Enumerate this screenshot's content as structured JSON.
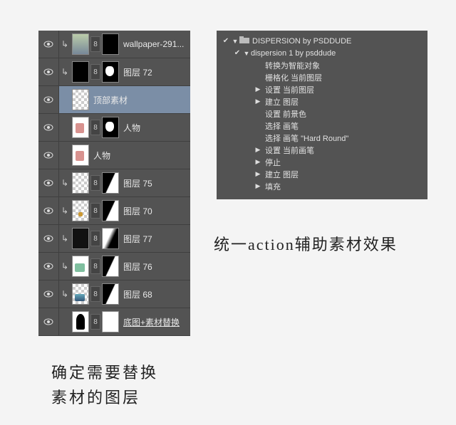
{
  "layers": {
    "items": [
      {
        "name": "wallpaper-291...",
        "clip": true,
        "mask": "black",
        "thumb": "photo"
      },
      {
        "name": "图层 72",
        "clip": true,
        "mask": "shape",
        "thumb": "black"
      },
      {
        "name": "顶部素材",
        "selected": true,
        "mask": null,
        "thumb": "checker"
      },
      {
        "name": "人物",
        "clip": false,
        "mask": "shape",
        "thumb": "person",
        "link": true
      },
      {
        "name": "人物",
        "clip": false,
        "mask": null,
        "thumb": "person"
      },
      {
        "name": "图层 75",
        "clip": true,
        "mask": "diag",
        "thumb": "checker",
        "link": true
      },
      {
        "name": "图层 70",
        "clip": true,
        "mask": "diag",
        "thumb": "checker-dot",
        "link": true
      },
      {
        "name": "图层 77",
        "clip": true,
        "mask": "diag2",
        "thumb": "dark",
        "link": true
      },
      {
        "name": "图层 76",
        "clip": true,
        "mask": "diag",
        "thumb": "photo2",
        "link": true
      },
      {
        "name": "图层 68",
        "clip": true,
        "mask": "diag",
        "thumb": "photo3",
        "link": true
      },
      {
        "name": "底图+素材替换",
        "clip": false,
        "mask": "white",
        "thumb": "sil",
        "underline": true,
        "link": true
      }
    ]
  },
  "actions": {
    "set_name": "DISPERSION by PSDDUDE",
    "action_name": "dispersion 1 by psddude",
    "steps": [
      "转换为智能对象",
      "栅格化 当前图层",
      "设置 当前图层",
      "建立 图层",
      "设置 前景色",
      "选择 画笔",
      "选择 画笔 \"Hard Round\"",
      "设置 当前画笔",
      "停止",
      "建立 图层",
      "填充"
    ],
    "step_disclosure": [
      false,
      false,
      true,
      true,
      false,
      false,
      false,
      true,
      true,
      true,
      true
    ]
  },
  "captions": {
    "left_line1": "确定需要替换",
    "left_line2": "素材的图层",
    "right": "统一action辅助素材效果"
  }
}
